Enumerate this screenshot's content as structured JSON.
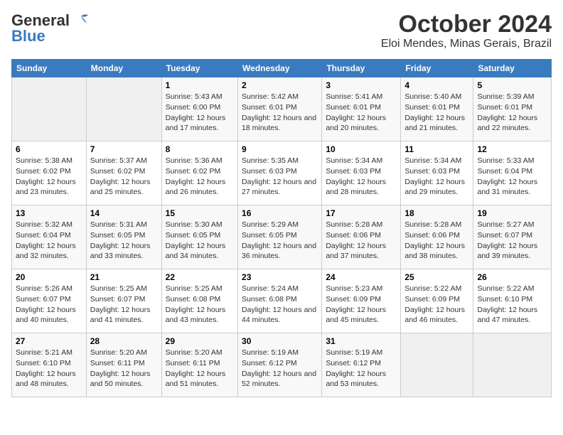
{
  "header": {
    "logo_line1": "General",
    "logo_line2": "Blue",
    "title": "October 2024",
    "subtitle": "Eloi Mendes, Minas Gerais, Brazil"
  },
  "weekdays": [
    "Sunday",
    "Monday",
    "Tuesday",
    "Wednesday",
    "Thursday",
    "Friday",
    "Saturday"
  ],
  "weeks": [
    [
      {
        "day": "",
        "sunrise": "",
        "sunset": "",
        "daylight": ""
      },
      {
        "day": "",
        "sunrise": "",
        "sunset": "",
        "daylight": ""
      },
      {
        "day": "1",
        "sunrise": "Sunrise: 5:43 AM",
        "sunset": "Sunset: 6:00 PM",
        "daylight": "Daylight: 12 hours and 17 minutes."
      },
      {
        "day": "2",
        "sunrise": "Sunrise: 5:42 AM",
        "sunset": "Sunset: 6:01 PM",
        "daylight": "Daylight: 12 hours and 18 minutes."
      },
      {
        "day": "3",
        "sunrise": "Sunrise: 5:41 AM",
        "sunset": "Sunset: 6:01 PM",
        "daylight": "Daylight: 12 hours and 20 minutes."
      },
      {
        "day": "4",
        "sunrise": "Sunrise: 5:40 AM",
        "sunset": "Sunset: 6:01 PM",
        "daylight": "Daylight: 12 hours and 21 minutes."
      },
      {
        "day": "5",
        "sunrise": "Sunrise: 5:39 AM",
        "sunset": "Sunset: 6:01 PM",
        "daylight": "Daylight: 12 hours and 22 minutes."
      }
    ],
    [
      {
        "day": "6",
        "sunrise": "Sunrise: 5:38 AM",
        "sunset": "Sunset: 6:02 PM",
        "daylight": "Daylight: 12 hours and 23 minutes."
      },
      {
        "day": "7",
        "sunrise": "Sunrise: 5:37 AM",
        "sunset": "Sunset: 6:02 PM",
        "daylight": "Daylight: 12 hours and 25 minutes."
      },
      {
        "day": "8",
        "sunrise": "Sunrise: 5:36 AM",
        "sunset": "Sunset: 6:02 PM",
        "daylight": "Daylight: 12 hours and 26 minutes."
      },
      {
        "day": "9",
        "sunrise": "Sunrise: 5:35 AM",
        "sunset": "Sunset: 6:03 PM",
        "daylight": "Daylight: 12 hours and 27 minutes."
      },
      {
        "day": "10",
        "sunrise": "Sunrise: 5:34 AM",
        "sunset": "Sunset: 6:03 PM",
        "daylight": "Daylight: 12 hours and 28 minutes."
      },
      {
        "day": "11",
        "sunrise": "Sunrise: 5:34 AM",
        "sunset": "Sunset: 6:03 PM",
        "daylight": "Daylight: 12 hours and 29 minutes."
      },
      {
        "day": "12",
        "sunrise": "Sunrise: 5:33 AM",
        "sunset": "Sunset: 6:04 PM",
        "daylight": "Daylight: 12 hours and 31 minutes."
      }
    ],
    [
      {
        "day": "13",
        "sunrise": "Sunrise: 5:32 AM",
        "sunset": "Sunset: 6:04 PM",
        "daylight": "Daylight: 12 hours and 32 minutes."
      },
      {
        "day": "14",
        "sunrise": "Sunrise: 5:31 AM",
        "sunset": "Sunset: 6:05 PM",
        "daylight": "Daylight: 12 hours and 33 minutes."
      },
      {
        "day": "15",
        "sunrise": "Sunrise: 5:30 AM",
        "sunset": "Sunset: 6:05 PM",
        "daylight": "Daylight: 12 hours and 34 minutes."
      },
      {
        "day": "16",
        "sunrise": "Sunrise: 5:29 AM",
        "sunset": "Sunset: 6:05 PM",
        "daylight": "Daylight: 12 hours and 36 minutes."
      },
      {
        "day": "17",
        "sunrise": "Sunrise: 5:28 AM",
        "sunset": "Sunset: 6:06 PM",
        "daylight": "Daylight: 12 hours and 37 minutes."
      },
      {
        "day": "18",
        "sunrise": "Sunrise: 5:28 AM",
        "sunset": "Sunset: 6:06 PM",
        "daylight": "Daylight: 12 hours and 38 minutes."
      },
      {
        "day": "19",
        "sunrise": "Sunrise: 5:27 AM",
        "sunset": "Sunset: 6:07 PM",
        "daylight": "Daylight: 12 hours and 39 minutes."
      }
    ],
    [
      {
        "day": "20",
        "sunrise": "Sunrise: 5:26 AM",
        "sunset": "Sunset: 6:07 PM",
        "daylight": "Daylight: 12 hours and 40 minutes."
      },
      {
        "day": "21",
        "sunrise": "Sunrise: 5:25 AM",
        "sunset": "Sunset: 6:07 PM",
        "daylight": "Daylight: 12 hours and 41 minutes."
      },
      {
        "day": "22",
        "sunrise": "Sunrise: 5:25 AM",
        "sunset": "Sunset: 6:08 PM",
        "daylight": "Daylight: 12 hours and 43 minutes."
      },
      {
        "day": "23",
        "sunrise": "Sunrise: 5:24 AM",
        "sunset": "Sunset: 6:08 PM",
        "daylight": "Daylight: 12 hours and 44 minutes."
      },
      {
        "day": "24",
        "sunrise": "Sunrise: 5:23 AM",
        "sunset": "Sunset: 6:09 PM",
        "daylight": "Daylight: 12 hours and 45 minutes."
      },
      {
        "day": "25",
        "sunrise": "Sunrise: 5:22 AM",
        "sunset": "Sunset: 6:09 PM",
        "daylight": "Daylight: 12 hours and 46 minutes."
      },
      {
        "day": "26",
        "sunrise": "Sunrise: 5:22 AM",
        "sunset": "Sunset: 6:10 PM",
        "daylight": "Daylight: 12 hours and 47 minutes."
      }
    ],
    [
      {
        "day": "27",
        "sunrise": "Sunrise: 5:21 AM",
        "sunset": "Sunset: 6:10 PM",
        "daylight": "Daylight: 12 hours and 48 minutes."
      },
      {
        "day": "28",
        "sunrise": "Sunrise: 5:20 AM",
        "sunset": "Sunset: 6:11 PM",
        "daylight": "Daylight: 12 hours and 50 minutes."
      },
      {
        "day": "29",
        "sunrise": "Sunrise: 5:20 AM",
        "sunset": "Sunset: 6:11 PM",
        "daylight": "Daylight: 12 hours and 51 minutes."
      },
      {
        "day": "30",
        "sunrise": "Sunrise: 5:19 AM",
        "sunset": "Sunset: 6:12 PM",
        "daylight": "Daylight: 12 hours and 52 minutes."
      },
      {
        "day": "31",
        "sunrise": "Sunrise: 5:19 AM",
        "sunset": "Sunset: 6:12 PM",
        "daylight": "Daylight: 12 hours and 53 minutes."
      },
      {
        "day": "",
        "sunrise": "",
        "sunset": "",
        "daylight": ""
      },
      {
        "day": "",
        "sunrise": "",
        "sunset": "",
        "daylight": ""
      }
    ]
  ]
}
